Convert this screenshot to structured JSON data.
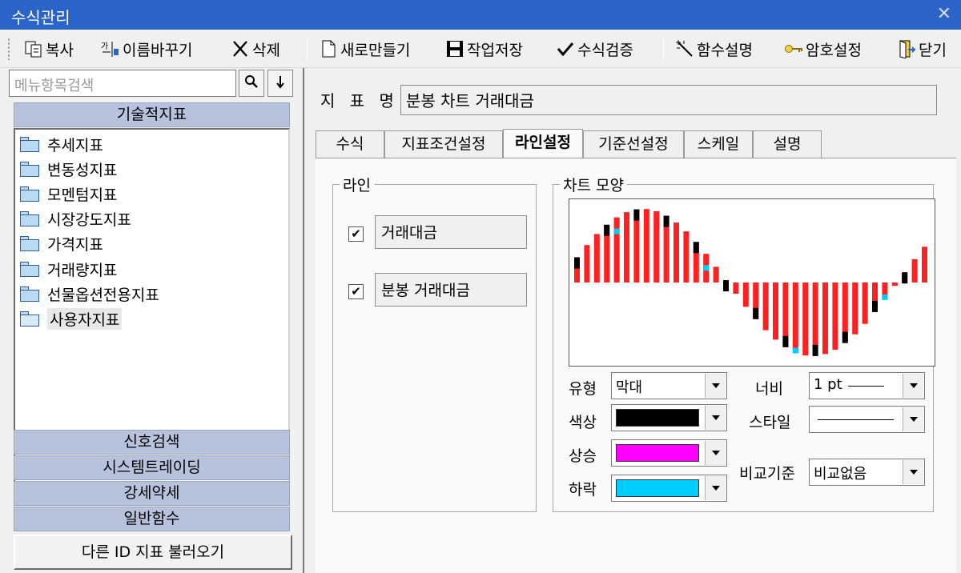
{
  "window": {
    "title": "수식관리",
    "close_glyph": "✕"
  },
  "toolbar": {
    "copy": "복사",
    "rename": "이름바꾸기",
    "delete": "삭제",
    "new": "새로만들기",
    "save": "작업저장",
    "verify": "수식검증",
    "func_desc": "함수설명",
    "password": "암호설정",
    "close": "닫기"
  },
  "sidebar": {
    "search_placeholder": "메뉴항목검색",
    "top_header": "기술적지표",
    "items": [
      {
        "label": "추세지표"
      },
      {
        "label": "변동성지표"
      },
      {
        "label": "모멘텀지표"
      },
      {
        "label": "시장강도지표"
      },
      {
        "label": "가격지표"
      },
      {
        "label": "거래량지표"
      },
      {
        "label": "선물옵션전용지표"
      },
      {
        "label": "사용자지표"
      }
    ],
    "sections": [
      "신호검색",
      "시스템트레이딩",
      "강세약세",
      "일반함수"
    ],
    "load_button": "다른 ID 지표 불러오기"
  },
  "main": {
    "indicator_label": "지 표 명",
    "indicator_name": "분봉 차트 거래대금",
    "tabs": [
      "수식",
      "지표조건설정",
      "라인설정",
      "기준선설정",
      "스케일",
      "설명"
    ],
    "active_tab": "라인설정",
    "line_group": {
      "title": "라인",
      "lines": [
        {
          "checked": true,
          "name": "거래대금"
        },
        {
          "checked": true,
          "name": "분봉 거래대금"
        }
      ]
    },
    "chart_group": {
      "title": "차트 모양",
      "type_label": "유형",
      "type_value": "막대",
      "color_label": "색상",
      "color_value": "#000000",
      "up_label": "상승",
      "up_value": "#ff00ff",
      "down_label": "하락",
      "down_value": "#00ccff",
      "width_label": "너비",
      "width_value": "1 pt",
      "style_label": "스타일",
      "compare_label": "비교기준",
      "compare_value": "비교없음"
    }
  },
  "check_mark": "✔"
}
